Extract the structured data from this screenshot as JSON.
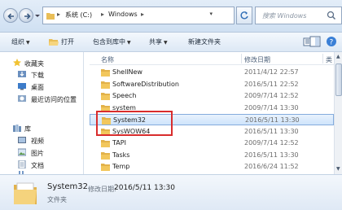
{
  "address": {
    "crumbs": [
      "系统 (C:)",
      "Windows"
    ],
    "search_placeholder": "搜索 Windows"
  },
  "toolbar": {
    "organize": "组织",
    "open": "打开",
    "include_in_library": "包含到库中",
    "share": "共享",
    "new_folder": "新建文件夹"
  },
  "nav": {
    "favorites": "收藏夹",
    "downloads": "下载",
    "desktop": "桌面",
    "recent": "最近访问的位置",
    "libraries": "库",
    "videos": "视频",
    "pictures": "图片",
    "documents": "文档",
    "music": "音乐"
  },
  "columns": {
    "name": "名称",
    "date": "修改日期",
    "type": "类"
  },
  "files": [
    {
      "name": "ShellNew",
      "date": "2011/4/12 22:57"
    },
    {
      "name": "SoftwareDistribution",
      "date": "2016/5/11 22:52"
    },
    {
      "name": "Speech",
      "date": "2009/7/14 12:52"
    },
    {
      "name": "system",
      "date": "2009/7/14 13:30"
    },
    {
      "name": "System32",
      "date": "2016/5/11 13:30"
    },
    {
      "name": "SysWOW64",
      "date": "2016/5/11 13:30"
    },
    {
      "name": "TAPI",
      "date": "2009/7/14 12:52"
    },
    {
      "name": "Tasks",
      "date": "2016/5/11 13:30"
    },
    {
      "name": "Temp",
      "date": "2016/6/24 11:52"
    }
  ],
  "details": {
    "name": "System32",
    "modified_label": "修改日期:",
    "modified_value": "2016/5/11 13:30",
    "type": "文件夹"
  },
  "colors": {
    "selection_border": "#84acdd",
    "highlight_box": "#d92d2d",
    "folder": "#f2c75c"
  }
}
